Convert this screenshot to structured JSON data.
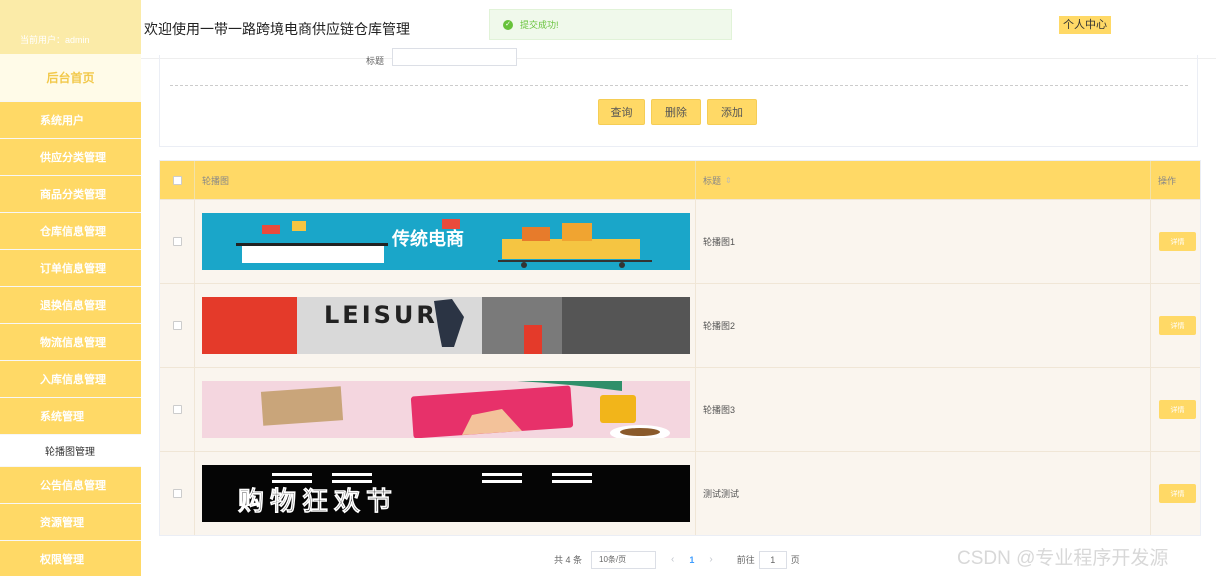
{
  "sidebar": {
    "current_user": "当前用户：admin",
    "home": "后台首页",
    "items": [
      {
        "label": "系统用户"
      },
      {
        "label": "供应分类管理"
      },
      {
        "label": "商品分类管理"
      },
      {
        "label": "仓库信息管理"
      },
      {
        "label": "订单信息管理"
      },
      {
        "label": "退换信息管理"
      },
      {
        "label": "物流信息管理"
      },
      {
        "label": "入库信息管理"
      },
      {
        "label": "系统管理"
      }
    ],
    "sub_item": "轮播图管理",
    "items_after": [
      {
        "label": "公告信息管理"
      },
      {
        "label": "资源管理"
      },
      {
        "label": "权限管理"
      }
    ]
  },
  "header": {
    "title": "欢迎使用一带一路跨境电商供应链仓库管理",
    "toast": "提交成功!",
    "profile": "个人中心"
  },
  "search": {
    "label": "标题",
    "buttons": {
      "query": "查询",
      "delete": "删除",
      "add": "添加"
    }
  },
  "table": {
    "headers": {
      "image": "轮播图",
      "title": "标题",
      "actions": "操作"
    },
    "rows": [
      {
        "title": "轮播图1",
        "detail": "详情",
        "image_text": "传统电商"
      },
      {
        "title": "轮播图2",
        "detail": "详情",
        "image_text": "LEISURE"
      },
      {
        "title": "轮播图3",
        "detail": "详情",
        "image_text": ""
      },
      {
        "title": "测试测试",
        "detail": "详情",
        "image_text": "购物狂欢节"
      }
    ]
  },
  "pagination": {
    "total": "共 4 条",
    "page_size": "10条/页",
    "prev": "‹",
    "current": "1",
    "next": "›",
    "goto": "前往",
    "goto_value": "1",
    "page_unit": "页"
  },
  "watermark": "CSDN @专业程序开发源",
  "colors": {
    "accent": "#ffd966",
    "success": "#67c23a",
    "row_bg": "#faf5ee"
  }
}
